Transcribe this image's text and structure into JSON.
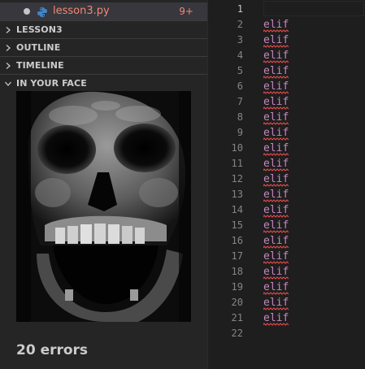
{
  "tab": {
    "file_name": "lesson3.py",
    "problem_count": "9+"
  },
  "sections": [
    {
      "label": "LESSON3",
      "expanded": false
    },
    {
      "label": "OUTLINE",
      "expanded": false
    },
    {
      "label": "TIMELINE",
      "expanded": false
    },
    {
      "label": "IN YOUR FACE",
      "expanded": true
    }
  ],
  "panel": {
    "image_icon": "screaming-skull",
    "error_text": "20 errors"
  },
  "editor": {
    "active_line": 1,
    "lines": [
      {
        "n": "1",
        "text": ""
      },
      {
        "n": "2",
        "text": "elif"
      },
      {
        "n": "3",
        "text": "elif"
      },
      {
        "n": "4",
        "text": "elif"
      },
      {
        "n": "5",
        "text": "elif"
      },
      {
        "n": "6",
        "text": "elif"
      },
      {
        "n": "7",
        "text": "elif"
      },
      {
        "n": "8",
        "text": "elif"
      },
      {
        "n": "9",
        "text": "elif"
      },
      {
        "n": "10",
        "text": "elif"
      },
      {
        "n": "11",
        "text": "elif"
      },
      {
        "n": "12",
        "text": "elif"
      },
      {
        "n": "13",
        "text": "elif"
      },
      {
        "n": "14",
        "text": "elif"
      },
      {
        "n": "15",
        "text": "elif"
      },
      {
        "n": "16",
        "text": "elif"
      },
      {
        "n": "17",
        "text": "elif"
      },
      {
        "n": "18",
        "text": "elif"
      },
      {
        "n": "19",
        "text": "elif"
      },
      {
        "n": "20",
        "text": "elif"
      },
      {
        "n": "21",
        "text": "elif"
      },
      {
        "n": "22",
        "text": ""
      }
    ]
  },
  "colors": {
    "keyword": "#c586c0",
    "error": "#f48771",
    "squiggle": "#f14c4c"
  }
}
